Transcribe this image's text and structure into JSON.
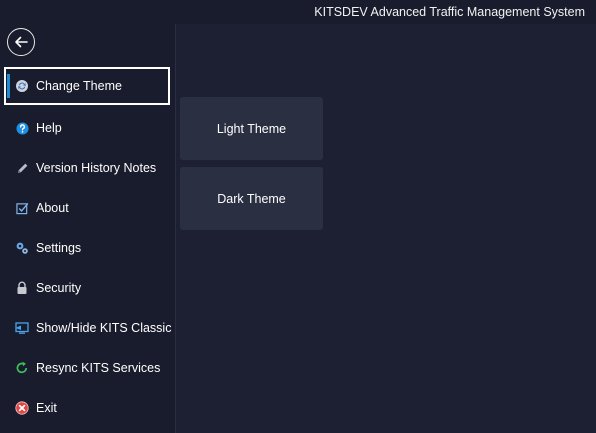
{
  "app": {
    "title": "KITSDEV Advanced Traffic Management System"
  },
  "sidebar": {
    "back_icon": "arrow-left-icon",
    "items": [
      {
        "label": "Change Theme",
        "icon": "refresh-icon",
        "active": true
      },
      {
        "label": "Help",
        "icon": "question-icon",
        "active": false
      },
      {
        "label": "Version History Notes",
        "icon": "pencil-icon",
        "active": false
      },
      {
        "label": "About",
        "icon": "checkbox-icon",
        "active": false
      },
      {
        "label": "Settings",
        "icon": "gears-icon",
        "active": false
      },
      {
        "label": "Security",
        "icon": "lock-icon",
        "active": false
      },
      {
        "label": "Show/Hide KITS Classic",
        "icon": "monitor-icon",
        "active": false
      },
      {
        "label": "Resync KITS Services",
        "icon": "sync-icon",
        "active": false
      },
      {
        "label": "Exit",
        "icon": "close-circle-icon",
        "active": false
      }
    ]
  },
  "main": {
    "theme_options": [
      {
        "label": "Light Theme"
      },
      {
        "label": "Dark Theme"
      }
    ]
  },
  "colors": {
    "background": "#191c2c",
    "panel": "#1d2033",
    "button": "#2b2f42",
    "accent": "#1c8fd4"
  }
}
